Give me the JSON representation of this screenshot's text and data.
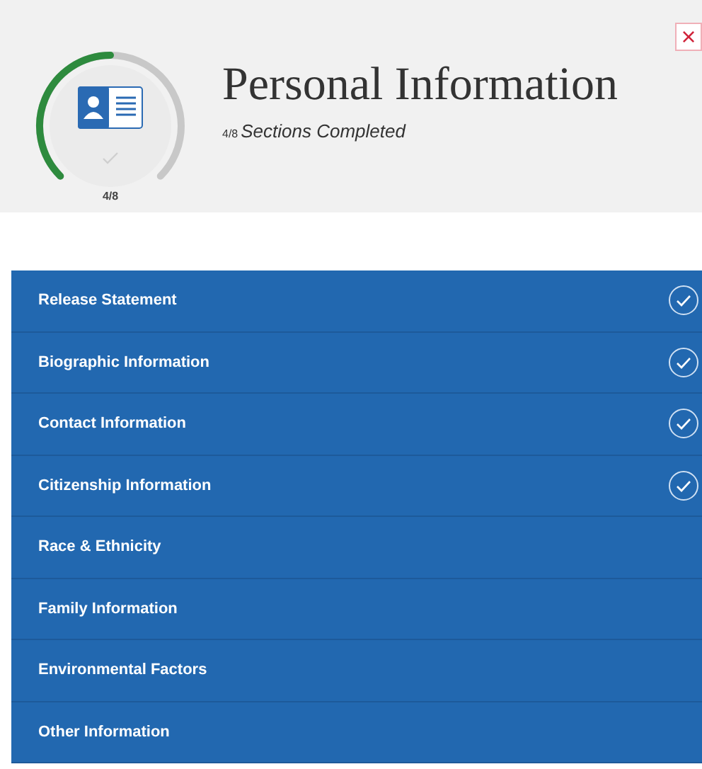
{
  "header": {
    "title": "Personal Information",
    "subtitle_count": "4/8",
    "subtitle": "Sections Completed",
    "progress": {
      "level": 0.5,
      "reading": "4/8"
    },
    "close": "×"
  },
  "sections": [
    {
      "label": "Release Statement",
      "completed": true
    },
    {
      "label": "Biographic Information",
      "completed": true
    },
    {
      "label": "Contact Information",
      "completed": true
    },
    {
      "label": "Citizenship Information",
      "completed": true
    },
    {
      "label": "Race & Ethnicity",
      "completed": false
    },
    {
      "label": "Family Information",
      "completed": false
    },
    {
      "label": "Environmental Factors",
      "completed": false
    },
    {
      "label": "Other Information",
      "completed": false
    }
  ]
}
